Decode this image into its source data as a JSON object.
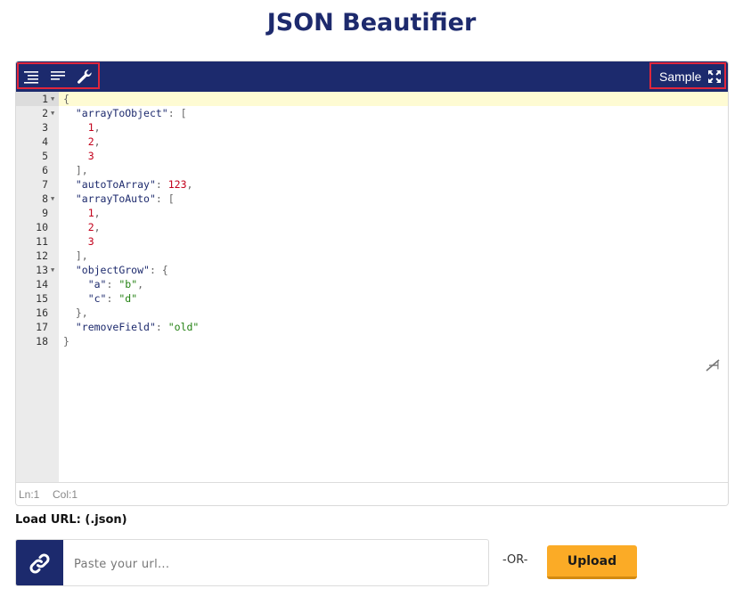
{
  "page": {
    "title": "JSON Beautifier"
  },
  "toolbar": {
    "left_icons": [
      "format-indent-icon",
      "compact-lines-icon",
      "wrench-icon"
    ],
    "sample_label": "Sample",
    "right_icon": "fullscreen-icon",
    "highlight_color": "#e0263b",
    "bar_color": "#1c2a6d"
  },
  "editor": {
    "line_numbers": [
      "1",
      "2",
      "3",
      "4",
      "5",
      "6",
      "7",
      "8",
      "9",
      "10",
      "11",
      "12",
      "13",
      "14",
      "15",
      "16",
      "17",
      "18"
    ],
    "fold_lines": [
      "1",
      "2",
      "8",
      "13"
    ],
    "lines": [
      [
        {
          "t": "punc",
          "v": "{"
        }
      ],
      [
        {
          "t": "plain",
          "v": "  "
        },
        {
          "t": "key",
          "v": "\"arrayToObject\""
        },
        {
          "t": "punc",
          "v": ": ["
        }
      ],
      [
        {
          "t": "plain",
          "v": "    "
        },
        {
          "t": "num",
          "v": "1"
        },
        {
          "t": "punc",
          "v": ","
        }
      ],
      [
        {
          "t": "plain",
          "v": "    "
        },
        {
          "t": "num",
          "v": "2"
        },
        {
          "t": "punc",
          "v": ","
        }
      ],
      [
        {
          "t": "plain",
          "v": "    "
        },
        {
          "t": "num",
          "v": "3"
        }
      ],
      [
        {
          "t": "plain",
          "v": "  "
        },
        {
          "t": "punc",
          "v": "],"
        }
      ],
      [
        {
          "t": "plain",
          "v": "  "
        },
        {
          "t": "key",
          "v": "\"autoToArray\""
        },
        {
          "t": "punc",
          "v": ": "
        },
        {
          "t": "num",
          "v": "123"
        },
        {
          "t": "punc",
          "v": ","
        }
      ],
      [
        {
          "t": "plain",
          "v": "  "
        },
        {
          "t": "key",
          "v": "\"arrayToAuto\""
        },
        {
          "t": "punc",
          "v": ": ["
        }
      ],
      [
        {
          "t": "plain",
          "v": "    "
        },
        {
          "t": "num",
          "v": "1"
        },
        {
          "t": "punc",
          "v": ","
        }
      ],
      [
        {
          "t": "plain",
          "v": "    "
        },
        {
          "t": "num",
          "v": "2"
        },
        {
          "t": "punc",
          "v": ","
        }
      ],
      [
        {
          "t": "plain",
          "v": "    "
        },
        {
          "t": "num",
          "v": "3"
        }
      ],
      [
        {
          "t": "plain",
          "v": "  "
        },
        {
          "t": "punc",
          "v": "],"
        }
      ],
      [
        {
          "t": "plain",
          "v": "  "
        },
        {
          "t": "key",
          "v": "\"objectGrow\""
        },
        {
          "t": "punc",
          "v": ": {"
        }
      ],
      [
        {
          "t": "plain",
          "v": "    "
        },
        {
          "t": "key",
          "v": "\"a\""
        },
        {
          "t": "punc",
          "v": ": "
        },
        {
          "t": "str",
          "v": "\"b\""
        },
        {
          "t": "punc",
          "v": ","
        }
      ],
      [
        {
          "t": "plain",
          "v": "    "
        },
        {
          "t": "key",
          "v": "\"c\""
        },
        {
          "t": "punc",
          "v": ": "
        },
        {
          "t": "str",
          "v": "\"d\""
        }
      ],
      [
        {
          "t": "plain",
          "v": "  "
        },
        {
          "t": "punc",
          "v": "},"
        }
      ],
      [
        {
          "t": "plain",
          "v": "  "
        },
        {
          "t": "key",
          "v": "\"removeField\""
        },
        {
          "t": "punc",
          "v": ": "
        },
        {
          "t": "str",
          "v": "\"old\""
        }
      ],
      [
        {
          "t": "punc",
          "v": "}"
        }
      ]
    ],
    "side_icon": "text-direction-icon"
  },
  "status": {
    "line": "Ln:1",
    "col": "Col:1"
  },
  "load": {
    "label": "Load URL: (.json)",
    "placeholder": "Paste your url...",
    "link_icon": "link-icon",
    "or_text": "-OR-",
    "upload_label": "Upload",
    "upload_color": "#fbab26"
  }
}
